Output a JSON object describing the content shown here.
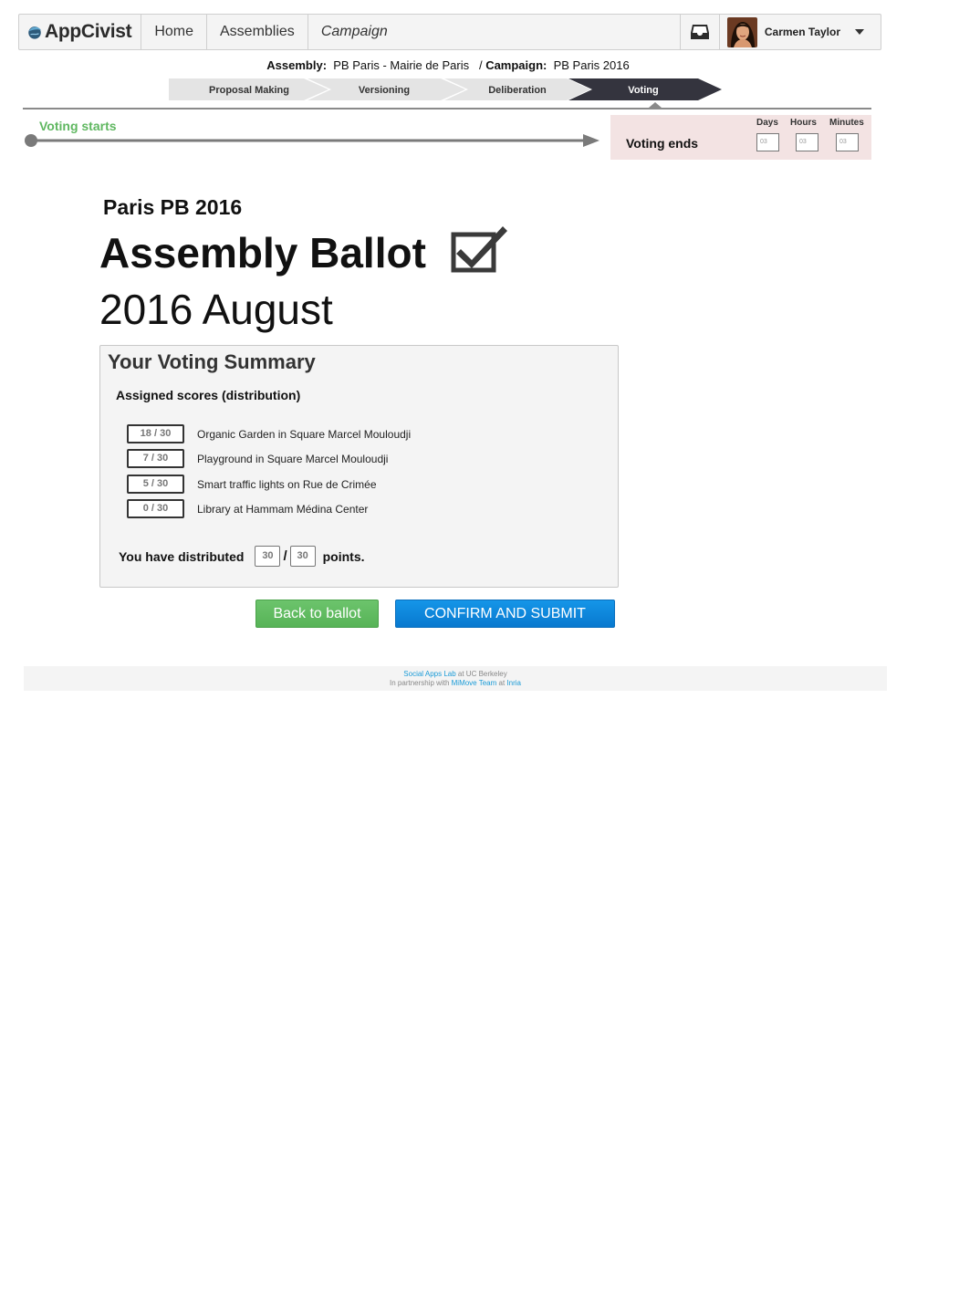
{
  "nav": {
    "brand": "AppCivist",
    "items": [
      "Home",
      "Assemblies",
      "Campaign"
    ],
    "user_name": "Carmen Taylor"
  },
  "context": {
    "assembly_label": "Assembly:",
    "assembly_value": "PB Paris - Mairie de Paris",
    "separator": "/",
    "campaign_label": "Campaign:",
    "campaign_value": "PB Paris 2016"
  },
  "phases": [
    {
      "label": "Proposal Making",
      "active": false
    },
    {
      "label": "Versioning",
      "active": false
    },
    {
      "label": "Deliberation",
      "active": false
    },
    {
      "label": "Voting",
      "active": true
    }
  ],
  "timeline": {
    "start_label": "Voting starts",
    "end_label": "Voting ends",
    "countdown": {
      "days_label": "Days",
      "days_value": "03",
      "hours_label": "Hours",
      "hours_value": "03",
      "minutes_label": "Minutes",
      "minutes_value": "03"
    }
  },
  "heading": {
    "subtitle": "Paris PB 2016",
    "title": "Assembly Ballot",
    "date": "2016 August"
  },
  "summary": {
    "title": "Your Voting Summary",
    "subtitle": "Assigned scores (distribution)",
    "items": [
      {
        "score": "18 / 30",
        "name": "Organic Garden in Square Marcel Mouloudji"
      },
      {
        "score": "7 / 30",
        "name": "Playground in Square Marcel Mouloudji"
      },
      {
        "score": "5 / 30",
        "name": "Smart traffic lights on Rue de Crimée"
      },
      {
        "score": "0 / 30",
        "name": "Library at Hammam Médina Center"
      }
    ],
    "distributed_prefix": "You have distributed",
    "distributed_value": "30",
    "distributed_slash": "/",
    "distributed_total": "30",
    "distributed_suffix": "points."
  },
  "buttons": {
    "back": "Back to ballot",
    "submit": "CONFIRM AND SUBMIT"
  },
  "footer": {
    "line1_link": "Social Apps Lab",
    "line1_text": " at UC Berkeley",
    "line2_text": "In partnership with ",
    "line2_link1": "MiMove Team",
    "line2_mid": " at ",
    "line2_link2": "Inria"
  },
  "colors": {
    "green": "#5fb760",
    "blue": "#0879cf",
    "active_phase": "#34343e",
    "inactive_phase": "#e4e4e4",
    "ends_bg": "#f3e3e3"
  }
}
